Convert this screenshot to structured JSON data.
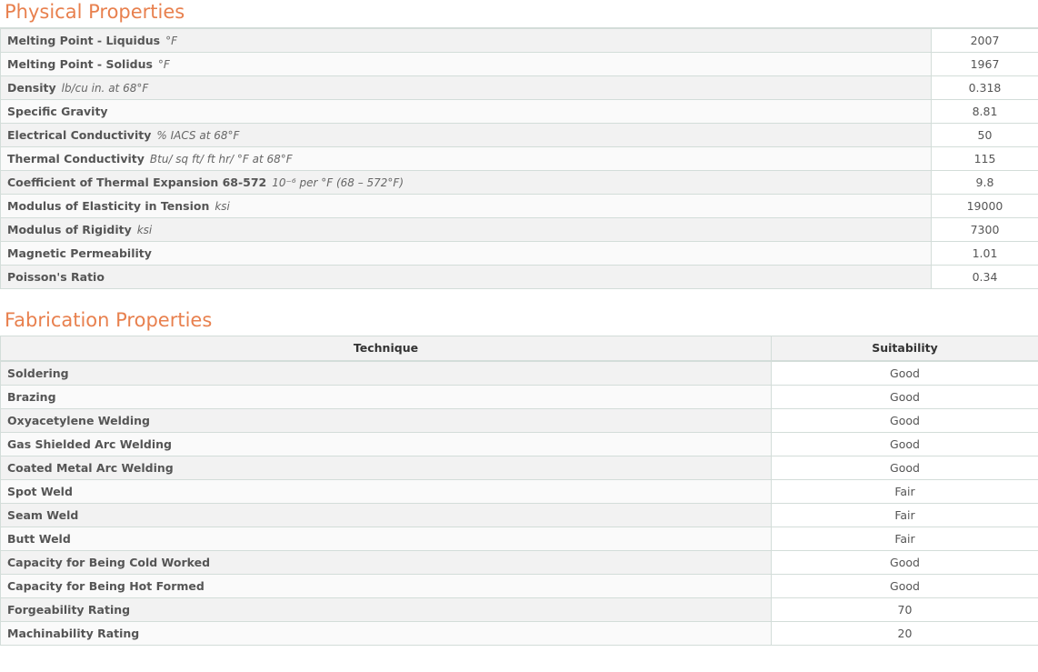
{
  "physical": {
    "title": "Physical Properties",
    "rows": [
      {
        "name": "Melting Point - Liquidus",
        "unit": "°F",
        "value": "2007"
      },
      {
        "name": "Melting Point - Solidus",
        "unit": "°F",
        "value": "1967"
      },
      {
        "name": "Density",
        "unit": "lb/cu in. at 68°F",
        "value": "0.318"
      },
      {
        "name": "Specific Gravity",
        "unit": "",
        "value": "8.81"
      },
      {
        "name": "Electrical Conductivity",
        "unit": "% IACS at 68°F",
        "value": "50"
      },
      {
        "name": "Thermal Conductivity",
        "unit": "Btu/ sq ft/ ft hr/ °F at 68°F",
        "value": "115"
      },
      {
        "name": "Coefficient of Thermal Expansion 68-572",
        "unit": "10⁻⁶ per °F (68 – 572°F)",
        "value": "9.8"
      },
      {
        "name": "Modulus of Elasticity in Tension",
        "unit": "ksi",
        "value": "19000"
      },
      {
        "name": "Modulus of Rigidity",
        "unit": "ksi",
        "value": "7300"
      },
      {
        "name": "Magnetic Permeability",
        "unit": "",
        "value": "1.01"
      },
      {
        "name": "Poisson's Ratio",
        "unit": "",
        "value": "0.34"
      }
    ]
  },
  "fabrication": {
    "title": "Fabrication Properties",
    "headers": {
      "technique": "Technique",
      "suitability": "Suitability"
    },
    "rows": [
      {
        "technique": "Soldering",
        "suitability": "Good"
      },
      {
        "technique": "Brazing",
        "suitability": "Good"
      },
      {
        "technique": "Oxyacetylene Welding",
        "suitability": "Good"
      },
      {
        "technique": "Gas Shielded Arc Welding",
        "suitability": "Good"
      },
      {
        "technique": "Coated Metal Arc Welding",
        "suitability": "Good"
      },
      {
        "technique": "Spot Weld",
        "suitability": "Fair"
      },
      {
        "technique": "Seam Weld",
        "suitability": "Fair"
      },
      {
        "technique": "Butt Weld",
        "suitability": "Fair"
      },
      {
        "technique": "Capacity for Being Cold Worked",
        "suitability": "Good"
      },
      {
        "technique": "Capacity for Being Hot Formed",
        "suitability": "Good"
      },
      {
        "technique": "Forgeability Rating",
        "suitability": "70"
      },
      {
        "technique": "Machinability Rating",
        "suitability": "20"
      }
    ]
  }
}
